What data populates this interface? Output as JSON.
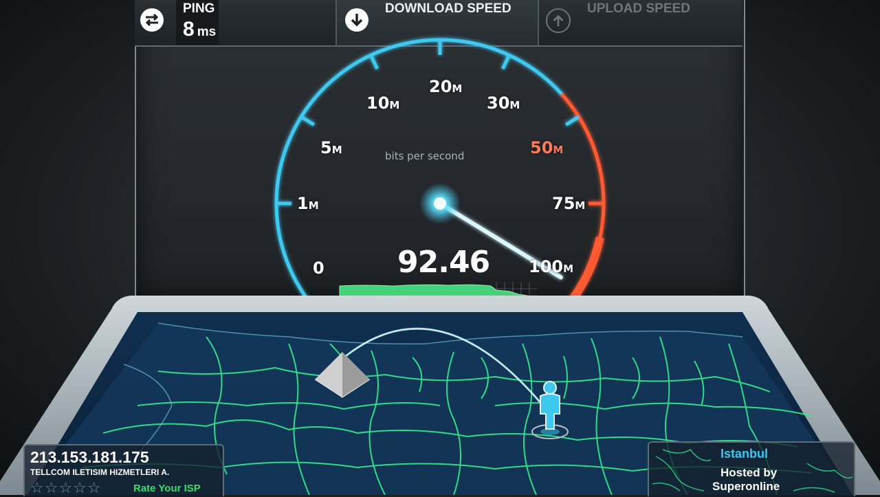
{
  "topbar": {
    "ping_label": "PING",
    "ping_value": "8",
    "ping_unit": "ms",
    "download_label": "DOWNLOAD SPEED",
    "upload_label": "UPLOAD SPEED"
  },
  "gauge": {
    "ticks": [
      {
        "num": "0",
        "unit": ""
      },
      {
        "num": "1",
        "unit": "M"
      },
      {
        "num": "5",
        "unit": "M"
      },
      {
        "num": "10",
        "unit": "M"
      },
      {
        "num": "20",
        "unit": "M"
      },
      {
        "num": "30",
        "unit": "M"
      },
      {
        "num": "50",
        "unit": "M"
      },
      {
        "num": "75",
        "unit": "M"
      },
      {
        "num": "100",
        "unit": "M"
      }
    ],
    "unit_caption": "bits per second",
    "speed_value": "92.46",
    "needle_mbps": 92.46,
    "accent_color": "#3fc8ef",
    "hot_color": "#ff5a32"
  },
  "client": {
    "ip": "213.153.181.175",
    "isp": "TELLCOM ILETISIM HIZMETLERI A.",
    "stars": "☆☆☆☆☆",
    "rate_label": "Rate Your ISP"
  },
  "server": {
    "city": "Istanbul",
    "hosted_label": "Hosted by",
    "host": "Superonline"
  }
}
